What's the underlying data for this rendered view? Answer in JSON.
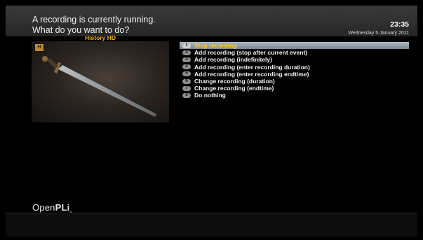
{
  "dialog": {
    "title": "A recording is currently running.\nWhat do you want to do?",
    "time": "23:35",
    "date": "Wednesday  5 January 2011"
  },
  "preview": {
    "channel": "History HD",
    "logo_text": "H"
  },
  "menu": {
    "selected_index": 0,
    "items": [
      {
        "key": "1",
        "label": "Stop recording"
      },
      {
        "key": "2",
        "label": "Add recording (stop after current event)"
      },
      {
        "key": "3",
        "label": "Add recording (indefinitely)"
      },
      {
        "key": "4",
        "label": "Add recording (enter recording duration)"
      },
      {
        "key": "5",
        "label": "Add recording (enter recording endtime)"
      },
      {
        "key": "6",
        "label": "Change recording (duration)"
      },
      {
        "key": "7",
        "label": "Change recording (endtime)"
      },
      {
        "key": "8",
        "label": "Do nothing"
      }
    ]
  },
  "brand": {
    "name_light": "Open",
    "name_bold": "PLi",
    "mark": "®"
  },
  "colors": {
    "selection_text": "#ffd000",
    "channel_name": "#f5b200"
  }
}
